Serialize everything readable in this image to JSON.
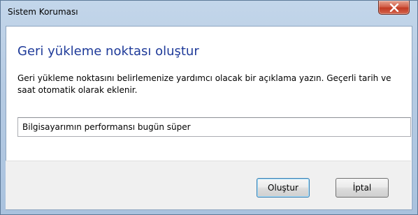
{
  "window": {
    "title": "Sistem Koruması"
  },
  "dialog": {
    "heading": "Geri yükleme noktası oluştur",
    "description": "Geri yükleme noktasını belirlemenize yardımcı olacak bir açıklama yazın. Geçerli tarih ve saat otomatik olarak eklenir.",
    "description_value": "Bilgisayarımın performansı bugün süper"
  },
  "buttons": {
    "create_label": "Oluştur",
    "cancel_label": "İptal"
  },
  "colors": {
    "heading": "#1e3a99",
    "close_button": "#c23a22",
    "frame": "#b6cbe3",
    "footer": "#f0f0f0"
  },
  "icons": {
    "close": "close-icon"
  }
}
